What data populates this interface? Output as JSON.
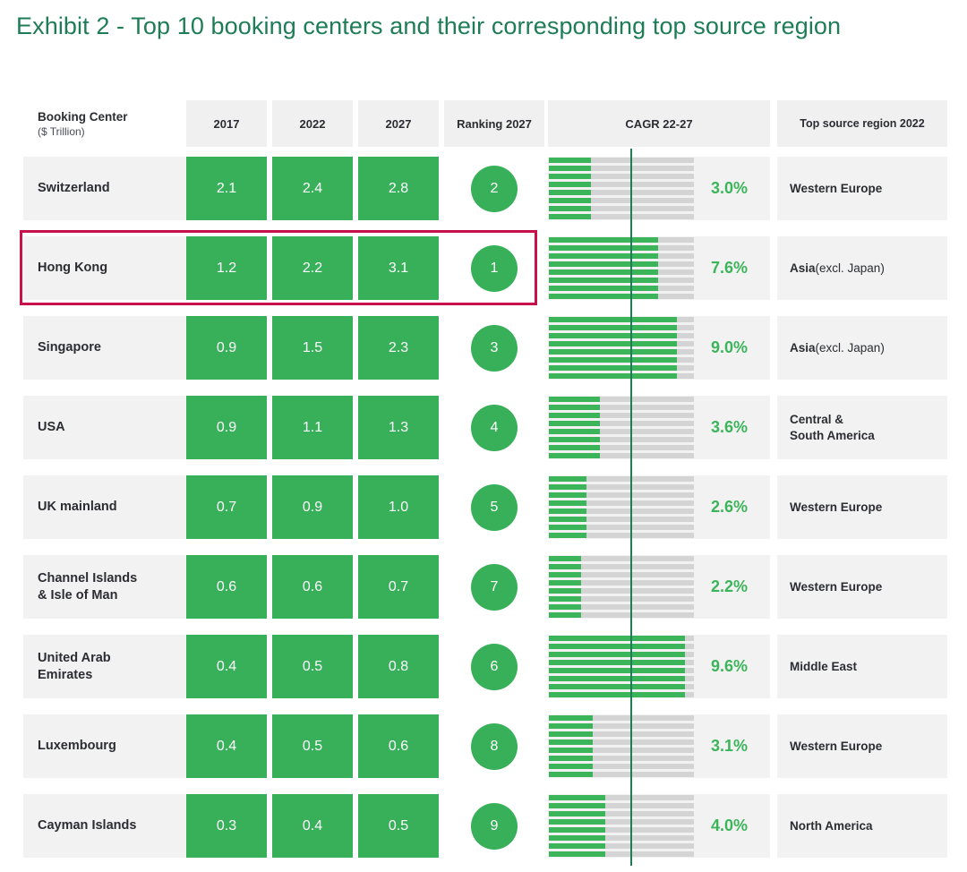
{
  "title": "Exhibit 2 - Top 10 booking centers and their corresponding top source region",
  "colors": {
    "title_green": "#1e7d56",
    "cell_green": "#38b05a",
    "bar_green": "#3cb45a",
    "bar_track": "#d4d4d4",
    "cell_grey": "#f2f2f2",
    "header_grey": "#f0f0f0",
    "highlight_red": "#c8104a",
    "refline_green": "#1e7d56"
  },
  "header": {
    "booking_center_main": "Booking Center",
    "booking_center_sub": "($ Trillion)",
    "y2017": "2017",
    "y2022": "2022",
    "y2027": "2027",
    "ranking": "Ranking 2027",
    "cagr": "CAGR 22-27",
    "source": "Top source region 2022"
  },
  "highlighted_row": "Hong Kong",
  "chart_data": {
    "type": "table",
    "title": "Exhibit 2 - Top 10 booking centers and their corresponding top source region",
    "columns": [
      "Booking Center ($ Trillion)",
      "2017",
      "2022",
      "2027",
      "Ranking 2027",
      "CAGR 22-27",
      "Top source region 2022"
    ],
    "bar_scale_max_pct": 10.2,
    "bar_reference_line_pct": 5.7,
    "bar_stripe_count": 8,
    "rows": [
      {
        "center": "Switzerland",
        "center_lines": [
          "Switzerland"
        ],
        "y2017": "2.1",
        "y2022": "2.4",
        "y2027": "2.8",
        "v2017": 2.1,
        "v2022": 2.4,
        "v2027": 2.8,
        "rank": "2",
        "cagr": "3.0%",
        "cagr_value": 3.0,
        "bar_fill_pct": 29,
        "source": "Western Europe",
        "source_bold": "Western Europe",
        "source_rest": "",
        "source_multiline": false,
        "highlighted": false
      },
      {
        "center": "Hong Kong",
        "center_lines": [
          "Hong Kong"
        ],
        "y2017": "1.2",
        "y2022": "2.2",
        "y2027": "3.1",
        "v2017": 1.2,
        "v2022": 2.2,
        "v2027": 3.1,
        "rank": "1",
        "cagr": "7.6%",
        "cagr_value": 7.6,
        "bar_fill_pct": 75,
        "source": "Asia (excl. Japan)",
        "source_bold": "Asia ",
        "source_rest": "(excl. Japan)",
        "source_multiline": false,
        "highlighted": true
      },
      {
        "center": "Singapore",
        "center_lines": [
          "Singapore"
        ],
        "y2017": "0.9",
        "y2022": "1.5",
        "y2027": "2.3",
        "v2017": 0.9,
        "v2022": 1.5,
        "v2027": 2.3,
        "rank": "3",
        "cagr": "9.0%",
        "cagr_value": 9.0,
        "bar_fill_pct": 88,
        "source": "Asia (excl. Japan)",
        "source_bold": "Asia ",
        "source_rest": "(excl. Japan)",
        "source_multiline": false,
        "highlighted": false
      },
      {
        "center": "USA",
        "center_lines": [
          "USA"
        ],
        "y2017": "0.9",
        "y2022": "1.1",
        "y2027": "1.3",
        "v2017": 0.9,
        "v2022": 1.1,
        "v2027": 1.3,
        "rank": "4",
        "cagr": "3.6%",
        "cagr_value": 3.6,
        "bar_fill_pct": 35,
        "source": "Central &\nSouth America",
        "source_bold": "Central &\nSouth America",
        "source_rest": "",
        "source_multiline": true,
        "highlighted": false
      },
      {
        "center": "UK mainland",
        "center_lines": [
          "UK mainland"
        ],
        "y2017": "0.7",
        "y2022": "0.9",
        "y2027": "1.0",
        "v2017": 0.7,
        "v2022": 0.9,
        "v2027": 1.0,
        "rank": "5",
        "cagr": "2.6%",
        "cagr_value": 2.6,
        "bar_fill_pct": 26,
        "source": "Western Europe",
        "source_bold": "Western Europe",
        "source_rest": "",
        "source_multiline": false,
        "highlighted": false
      },
      {
        "center": "Channel Islands\n& Isle of Man",
        "center_lines": [
          "Channel Islands",
          "& Isle of Man"
        ],
        "y2017": "0.6",
        "y2022": "0.6",
        "y2027": "0.7",
        "v2017": 0.6,
        "v2022": 0.6,
        "v2027": 0.7,
        "rank": "7",
        "cagr": "2.2%",
        "cagr_value": 2.2,
        "bar_fill_pct": 22,
        "source": "Western Europe",
        "source_bold": "Western Europe",
        "source_rest": "",
        "source_multiline": false,
        "highlighted": false
      },
      {
        "center": "United Arab\nEmirates",
        "center_lines": [
          "United Arab",
          "Emirates"
        ],
        "y2017": "0.4",
        "y2022": "0.5",
        "y2027": "0.8",
        "v2017": 0.4,
        "v2022": 0.5,
        "v2027": 0.8,
        "rank": "6",
        "cagr": "9.6%",
        "cagr_value": 9.6,
        "bar_fill_pct": 94,
        "source": "Middle East",
        "source_bold": "Middle East",
        "source_rest": "",
        "source_multiline": false,
        "highlighted": false
      },
      {
        "center": "Luxembourg",
        "center_lines": [
          "Luxembourg"
        ],
        "y2017": "0.4",
        "y2022": "0.5",
        "y2027": "0.6",
        "v2017": 0.4,
        "v2022": 0.5,
        "v2027": 0.6,
        "rank": "8",
        "cagr": "3.1%",
        "cagr_value": 3.1,
        "bar_fill_pct": 30,
        "source": "Western Europe",
        "source_bold": "Western Europe",
        "source_rest": "",
        "source_multiline": false,
        "highlighted": false
      },
      {
        "center": "Cayman Islands",
        "center_lines": [
          "Cayman Islands"
        ],
        "y2017": "0.3",
        "y2022": "0.4",
        "y2027": "0.5",
        "v2017": 0.3,
        "v2022": 0.4,
        "v2027": 0.5,
        "rank": "9",
        "cagr": "4.0%",
        "cagr_value": 4.0,
        "bar_fill_pct": 39,
        "source": "North America",
        "source_bold": "North America",
        "source_rest": "",
        "source_multiline": false,
        "highlighted": false
      }
    ]
  }
}
